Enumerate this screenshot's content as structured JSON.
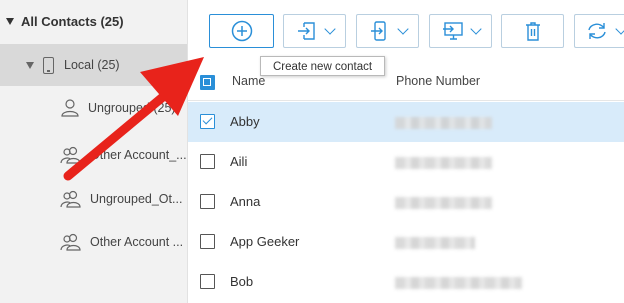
{
  "sidebar": {
    "root_label": "All Contacts  (25)",
    "local_label": "Local  (25)",
    "groups": [
      {
        "label": "Ungrouped  (25)"
      },
      {
        "label": "Other Account_..."
      },
      {
        "label": "Ungrouped_Ot..."
      },
      {
        "label": "Other Account ..."
      }
    ]
  },
  "toolbar": {
    "tooltip": "Create new contact",
    "icons": [
      "add-icon",
      "import-icon",
      "export-device-icon",
      "export-computer-icon",
      "delete-icon",
      "refresh-icon"
    ]
  },
  "table": {
    "columns": {
      "name": "Name",
      "phone": "Phone Number"
    },
    "rows": [
      {
        "name": "Abby",
        "checked": true
      },
      {
        "name": "Aili",
        "checked": false
      },
      {
        "name": "Anna",
        "checked": false
      },
      {
        "name": "App Geeker",
        "checked": false
      },
      {
        "name": "Bob",
        "checked": false
      }
    ]
  },
  "colors": {
    "accent": "#2a8fd8",
    "selected_row": "#d8ebfa",
    "arrow": "#e8231b",
    "sidebar_bg": "#f2f2f2"
  }
}
